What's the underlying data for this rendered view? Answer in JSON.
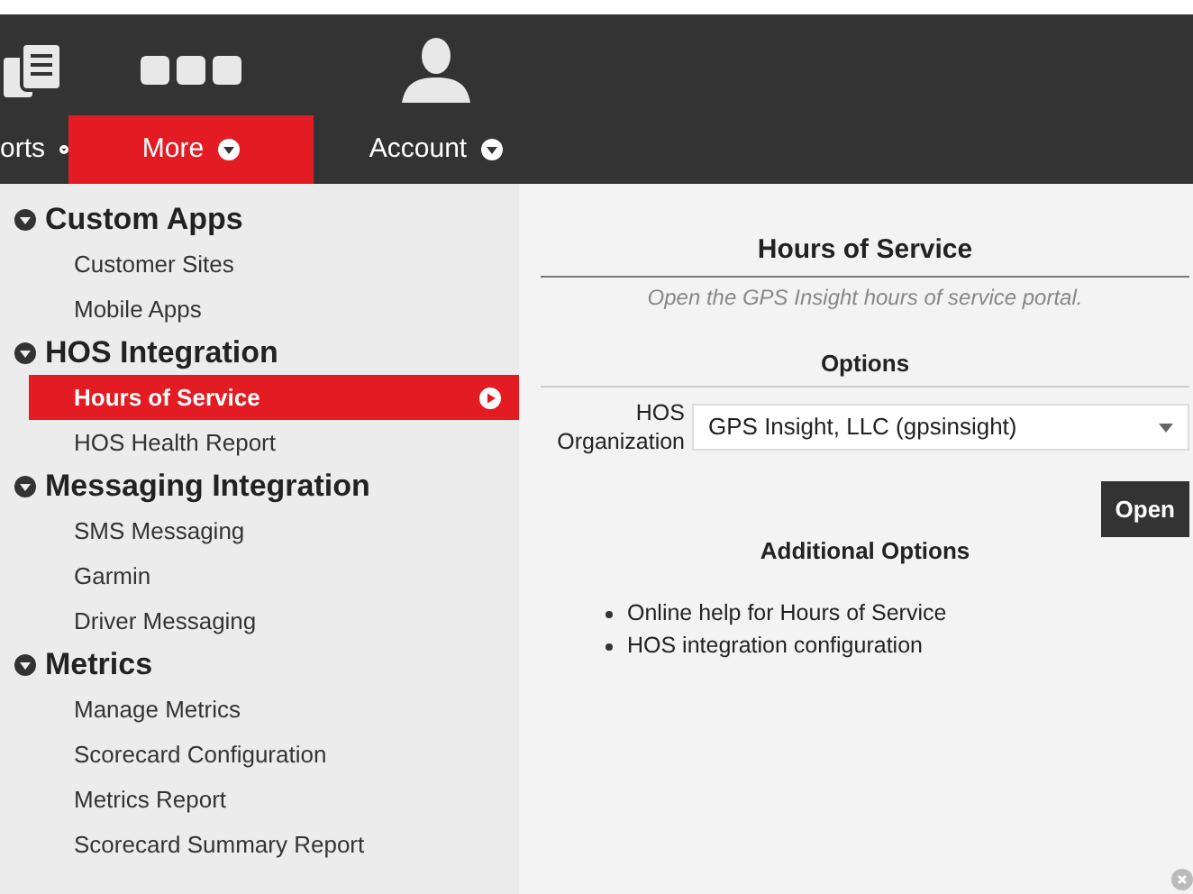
{
  "nav": {
    "items": [
      {
        "label": "orts",
        "kind": "documents",
        "selected": false
      },
      {
        "label": "More",
        "kind": "dots",
        "selected": true
      },
      {
        "label": "Account",
        "kind": "person",
        "selected": false
      }
    ]
  },
  "sidebar": {
    "groups": [
      {
        "title": "Custom Apps",
        "items": [
          {
            "label": "Customer Sites",
            "selected": false
          },
          {
            "label": "Mobile Apps",
            "selected": false
          }
        ]
      },
      {
        "title": "HOS Integration",
        "items": [
          {
            "label": "Hours of Service",
            "selected": true
          },
          {
            "label": "HOS Health Report",
            "selected": false
          }
        ]
      },
      {
        "title": "Messaging Integration",
        "items": [
          {
            "label": "SMS Messaging",
            "selected": false
          },
          {
            "label": "Garmin",
            "selected": false
          },
          {
            "label": "Driver Messaging",
            "selected": false
          }
        ]
      },
      {
        "title": "Metrics",
        "items": [
          {
            "label": "Manage Metrics",
            "selected": false
          },
          {
            "label": "Scorecard Configuration",
            "selected": false
          },
          {
            "label": "Metrics Report",
            "selected": false
          },
          {
            "label": "Scorecard Summary Report",
            "selected": false
          }
        ]
      }
    ]
  },
  "panel": {
    "title": "Hours of Service",
    "subtitle": "Open the GPS Insight hours of service portal.",
    "options_heading": "Options",
    "field": {
      "label": "HOS Organization",
      "value": "GPS Insight, LLC (gpsinsight)"
    },
    "open_button": "Open",
    "additional_heading": "Additional Options",
    "links": [
      "Online help for Hours of Service",
      "HOS integration configuration"
    ]
  }
}
